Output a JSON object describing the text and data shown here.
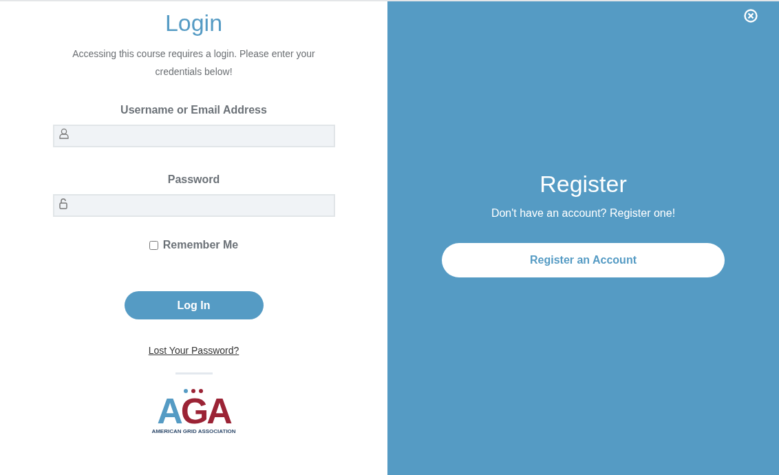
{
  "login": {
    "title": "Login",
    "intro": "Accessing this course requires a login. Please enter your credentials below!",
    "fields": [
      {
        "kind": "user",
        "label": "Username or Email Address"
      },
      {
        "kind": "lock",
        "label": "Password"
      }
    ],
    "remember": {
      "label": "Remember Me",
      "checked": false
    },
    "submit": "Log In",
    "lost_password": "Lost Your Password?",
    "logo": {
      "letters": "AGA",
      "tagline": "AMERICAN GRID ASSOCIATION"
    }
  },
  "register": {
    "title": "Register",
    "subtitle": "Don't have an account? Register one!",
    "button": "Register an Account"
  }
}
